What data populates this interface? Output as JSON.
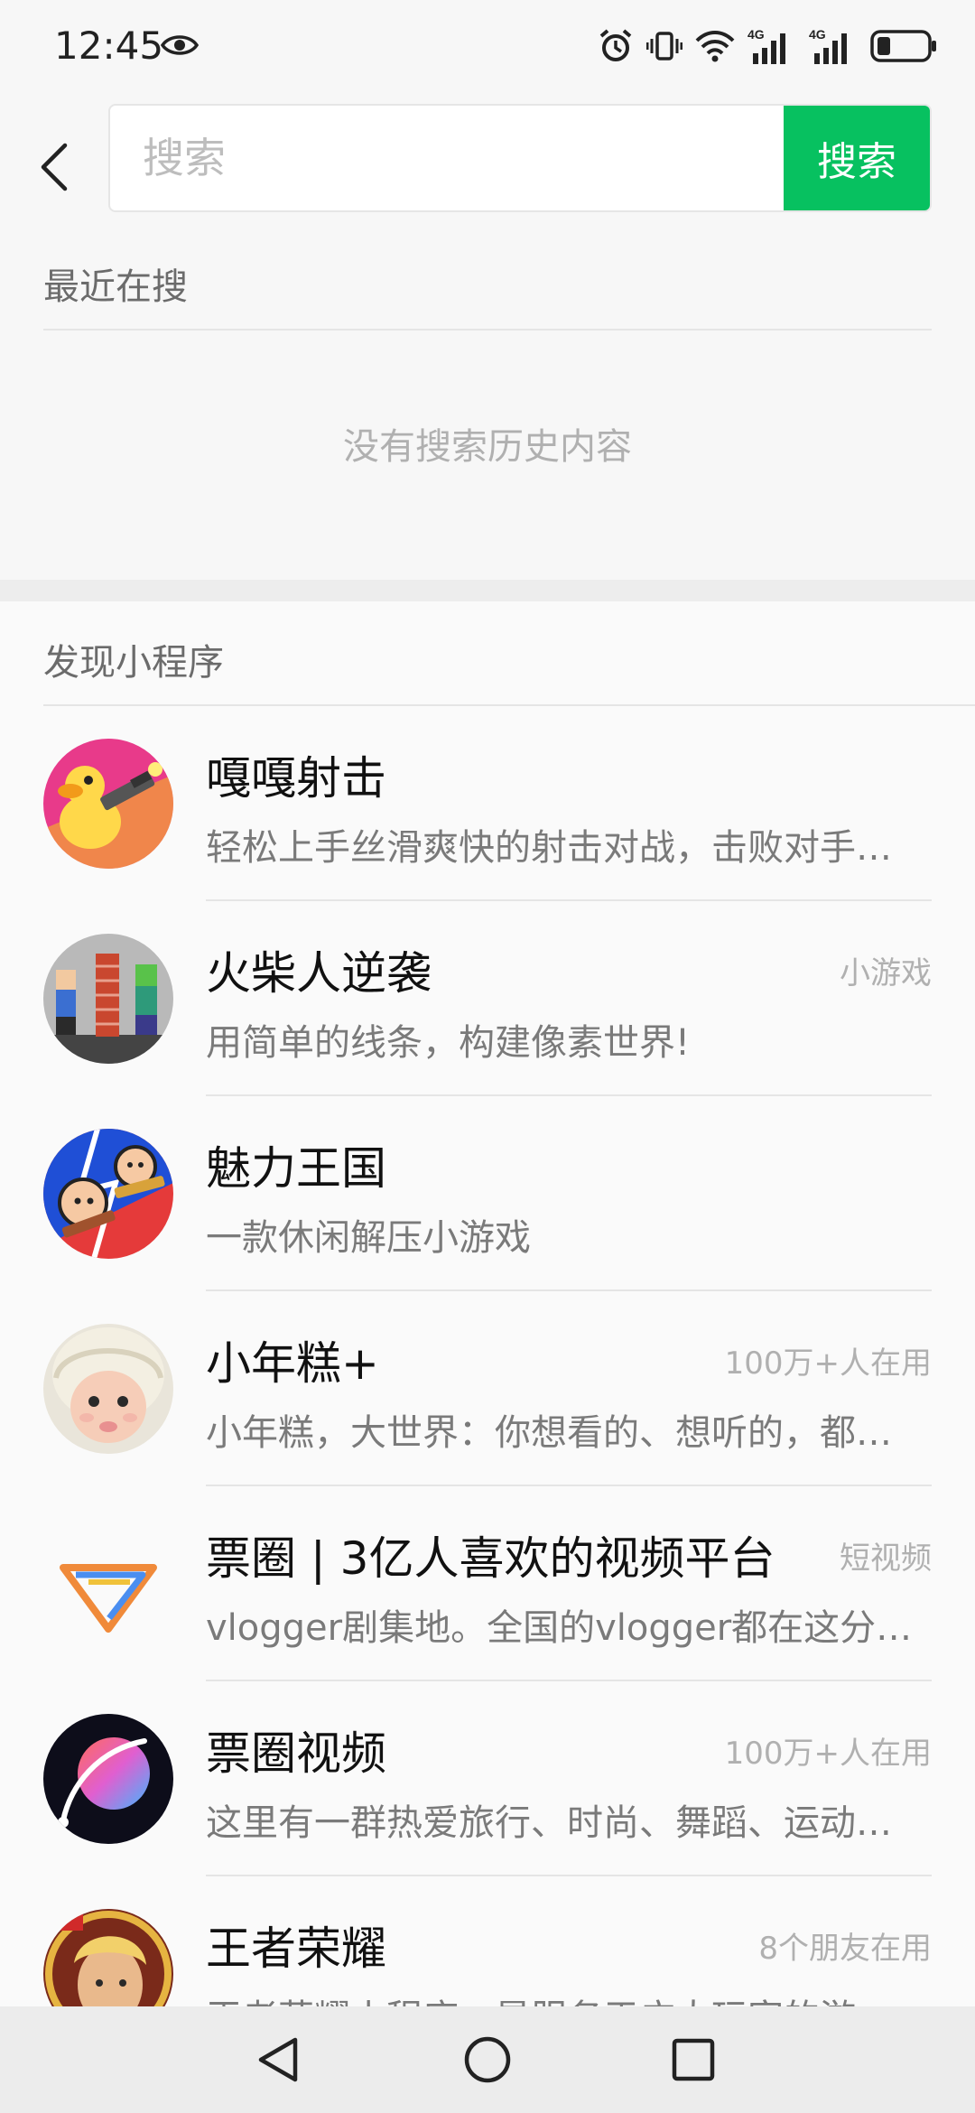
{
  "status_bar": {
    "time": "12:45",
    "icons": [
      "eye-icon",
      "alarm-icon",
      "vibrate-icon",
      "wifi-icon",
      "signal-4g-icon",
      "signal-4g-icon",
      "battery-icon"
    ],
    "network_label_1": "4G",
    "network_label_2": "4G"
  },
  "search": {
    "placeholder": "搜索",
    "button_label": "搜索",
    "accent_color": "#07c160"
  },
  "recent": {
    "title": "最近在搜",
    "empty_text": "没有搜索历史内容"
  },
  "discover": {
    "title": "发现小程序",
    "items": [
      {
        "name": "嘎嘎射击",
        "tag": "",
        "desc": "轻松上手丝滑爽快的射击对战，击败对手…",
        "icon": "duck-shooter-icon"
      },
      {
        "name": "火柴人逆袭",
        "tag": "小游戏",
        "desc": "用简单的线条，构建像素世界!",
        "icon": "stickman-pixel-icon"
      },
      {
        "name": "魅力王国",
        "tag": "",
        "desc": "一款休闲解压小游戏",
        "icon": "charm-kingdom-icon"
      },
      {
        "name": "小年糕+",
        "tag": "100万+人在用",
        "desc": "小年糕，大世界：你想看的、想听的，都…",
        "icon": "baby-photo-icon"
      },
      {
        "name": "票圈 | 3亿人喜欢的视频平台",
        "tag": "短视频",
        "desc": "vlogger剧集地。全国的vlogger都在这分…",
        "icon": "piaoquan-logo-icon"
      },
      {
        "name": "票圈视频",
        "tag": "100万+人在用",
        "desc": "这里有一群热爱旅行、时尚、舞蹈、运动…",
        "icon": "planet-icon"
      },
      {
        "name": "王者荣耀",
        "tag": "8个朋友在用",
        "desc": "王者荣耀小程序，是服务于广大玩家的游…",
        "icon": "hero-avatar-icon"
      }
    ]
  },
  "nav": {
    "icons": [
      "back-triangle-icon",
      "home-circle-icon",
      "recent-square-icon"
    ]
  }
}
